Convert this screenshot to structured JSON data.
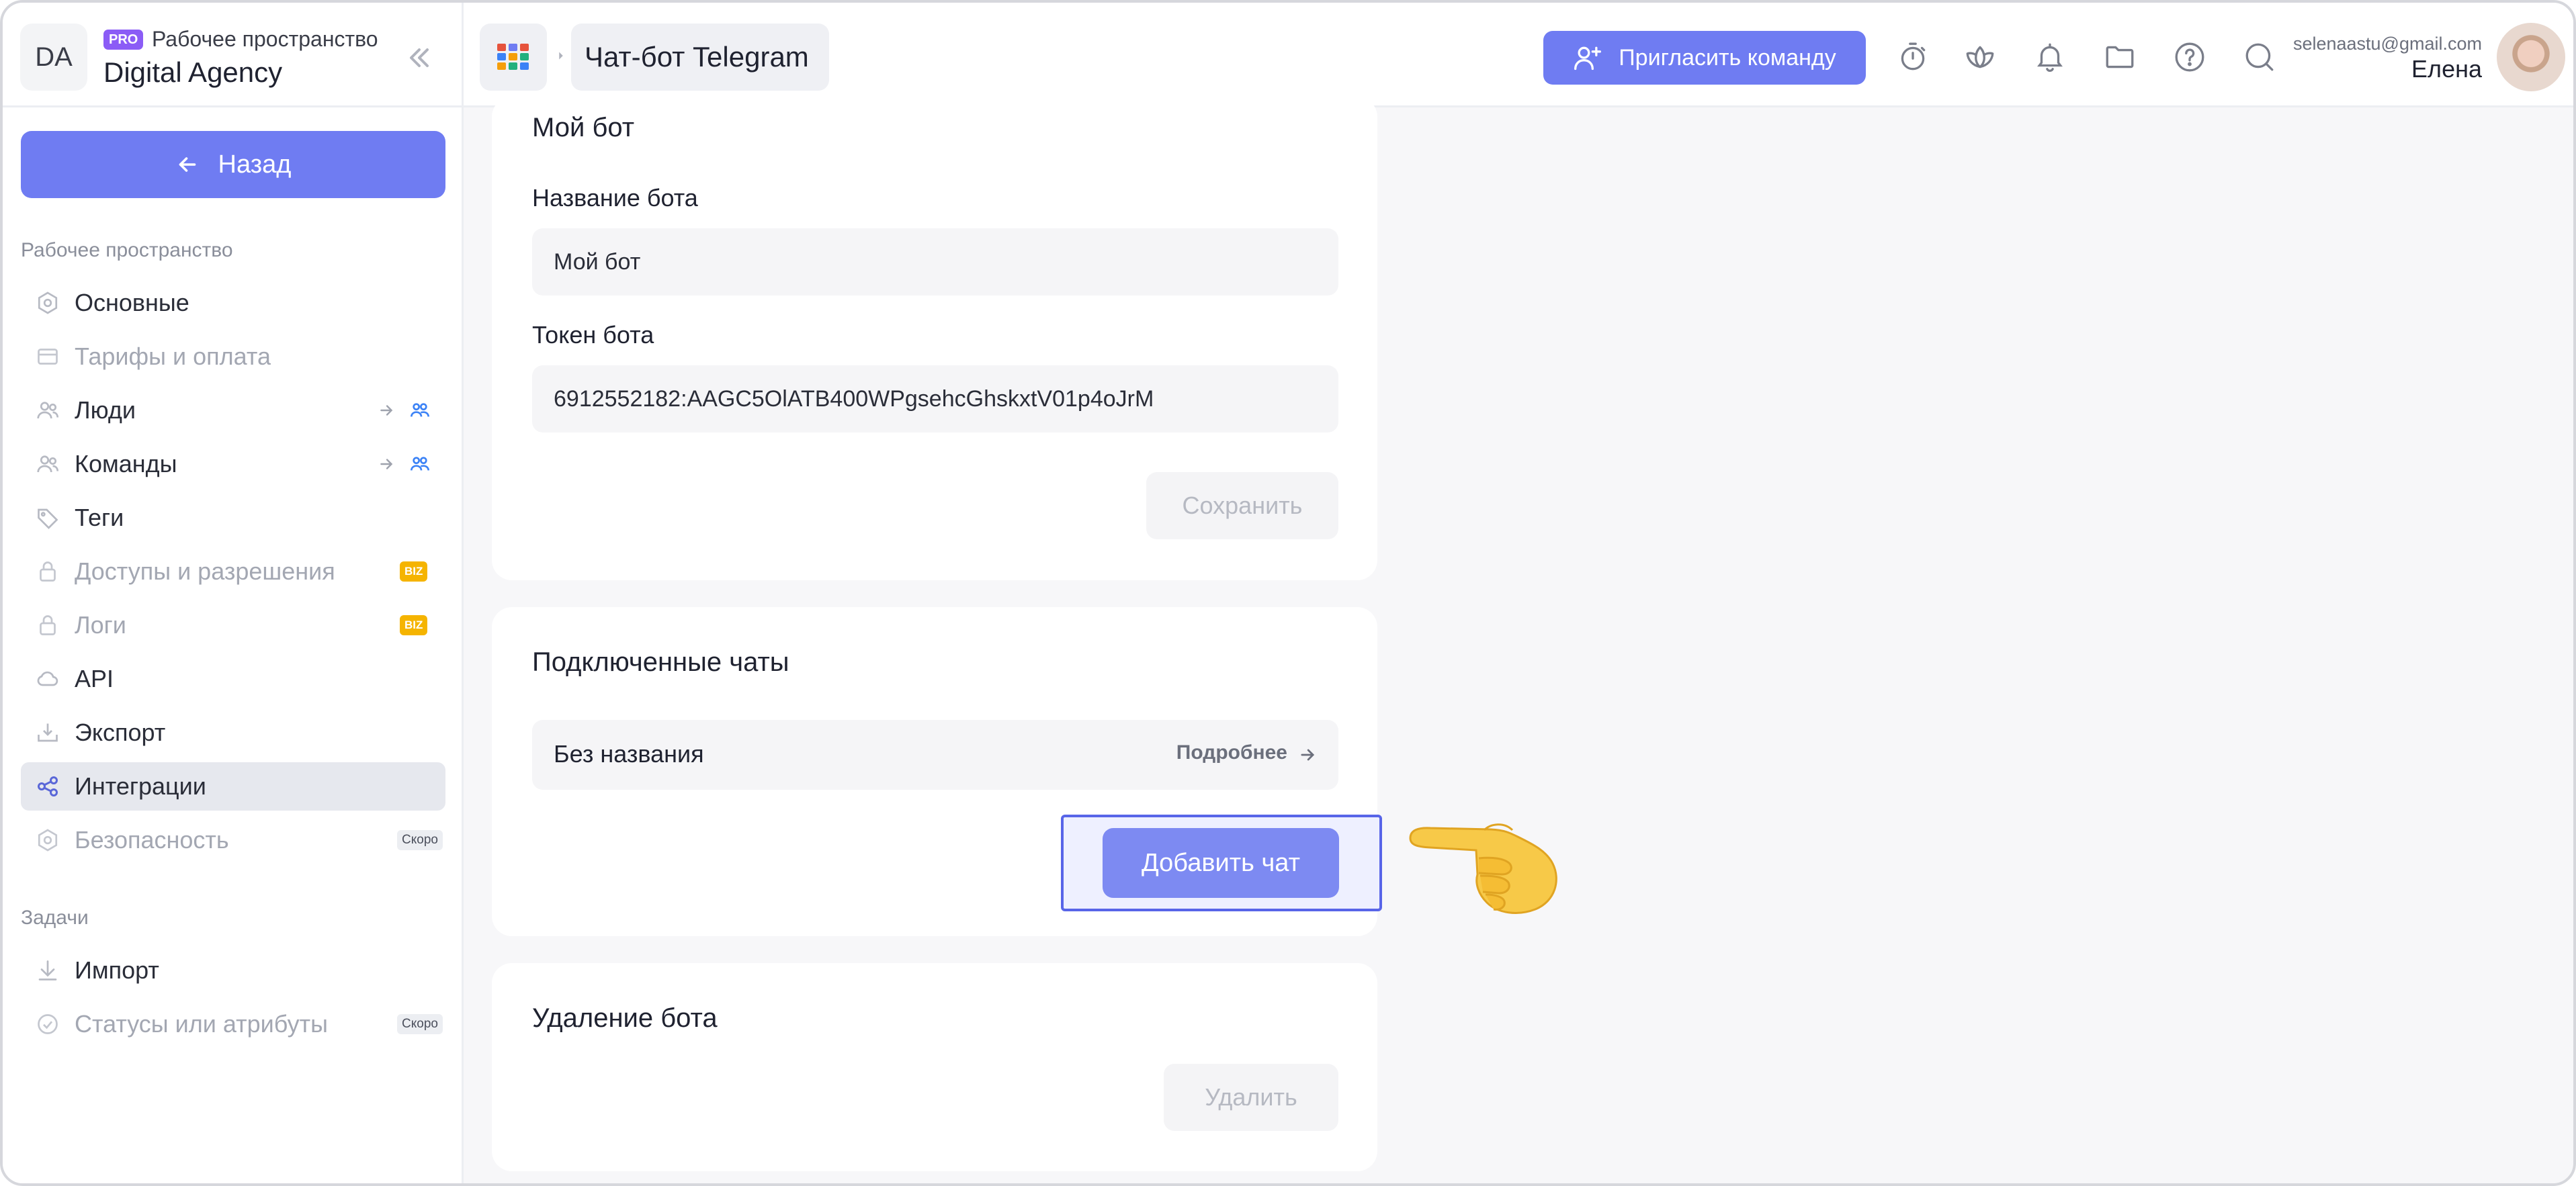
{
  "workspace": {
    "avatar_initials": "DA",
    "pro_badge": "PRO",
    "label": "Рабочее пространство",
    "name": "Digital Agency"
  },
  "sidebar": {
    "back_label": "Назад",
    "section_workspace": "Рабочее пространство",
    "section_tasks": "Задачи",
    "items": [
      {
        "label": "Основные",
        "icon": "settings-icon"
      },
      {
        "label": "Тарифы и оплата",
        "icon": "card-icon"
      },
      {
        "label": "Люди",
        "icon": "people-icon"
      },
      {
        "label": "Команды",
        "icon": "team-icon"
      },
      {
        "label": "Теги",
        "icon": "tag-icon"
      },
      {
        "label": "Доступы и разрешения",
        "icon": "lock-icon",
        "badge": "BIZ"
      },
      {
        "label": "Логи",
        "icon": "lock-icon",
        "badge": "BIZ"
      },
      {
        "label": "API",
        "icon": "cloud-icon"
      },
      {
        "label": "Экспорт",
        "icon": "export-icon"
      },
      {
        "label": "Интеграции",
        "icon": "integrations-icon"
      },
      {
        "label": "Безопасность",
        "icon": "shield-icon",
        "badge": "Скоро"
      }
    ],
    "task_items": [
      {
        "label": "Импорт",
        "icon": "download-icon"
      },
      {
        "label": "Статусы или атрибуты",
        "icon": "status-icon",
        "badge": "Скоро"
      }
    ]
  },
  "topbar": {
    "breadcrumb": "Чат-бот Telegram",
    "invite_label": "Пригласить команду",
    "user_email": "selenaastu@gmail.com",
    "user_name": "Елена"
  },
  "bot_card": {
    "title": "Мой бот",
    "name_label": "Название бота",
    "name_value": "Мой бот",
    "token_label": "Токен бота",
    "token_value": "6912552182:AAGC5OlATB400WPgsehcGhskxtV01p4oJrM",
    "save_label": "Сохранить"
  },
  "chats_card": {
    "title": "Подключенные чаты",
    "chats": [
      {
        "name": "Без названия",
        "more_label": "Подробнее"
      }
    ],
    "add_chat_label": "Добавить чат"
  },
  "delete_card": {
    "title": "Удаление бота",
    "delete_label": "Удалить"
  },
  "colors": {
    "accent": "#6f7cf2",
    "biz_badge": "#f5b400",
    "pro_badge": "#8b5cf6",
    "highlight_border": "#5865e8"
  }
}
